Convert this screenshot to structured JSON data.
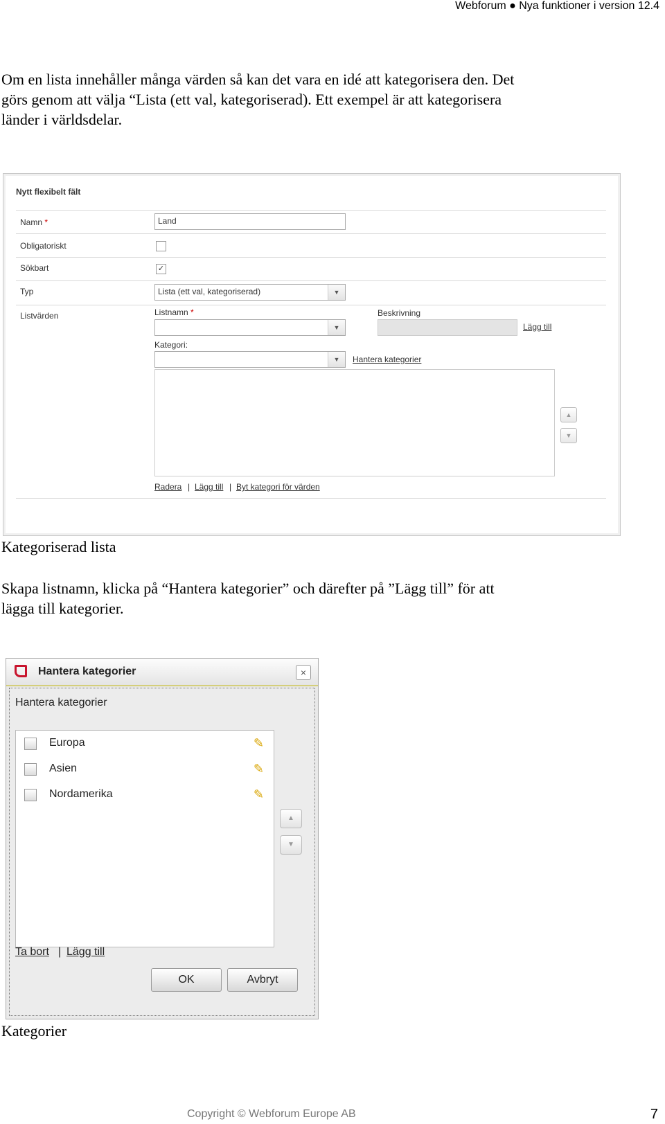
{
  "header": {
    "text": "Webforum ● Nya funktioner i version 12.4"
  },
  "intro": {
    "line1": "Om en lista innehåller många värden så kan det vara en idé att kategorisera den. Det",
    "line2": "görs genom att välja “Lista (ett val, kategoriserad). Ett exempel är att kategorisera",
    "line3": "länder i världsdelar."
  },
  "form": {
    "title": "Nytt flexibelt fält",
    "name_label": "Namn",
    "required_mark": "*",
    "name_value": "Land",
    "mandatory_label": "Obligatoriskt",
    "mandatory_checked": false,
    "searchable_label": "Sökbart",
    "searchable_checked": true,
    "check_glyph": "✓",
    "type_label": "Typ",
    "type_value": "Lista (ett val, kategoriserad)",
    "listvalues_label": "Listvärden",
    "listname_label": "Listnamn",
    "description_label": "Beskrivning",
    "add_label": "Lägg till",
    "category_label": "Kategori:",
    "manage_categories_label": "Hantera kategorier",
    "delete_label": "Radera",
    "add2_label": "Lägg till",
    "change_category_label": "Byt kategori för värden",
    "separator": "|",
    "up_icon": "▲",
    "down_icon": "▼"
  },
  "caption1": "Kategoriserad lista",
  "para2": {
    "line1": "Skapa listnamn, klicka på “Hantera kategorier” och därefter på ”Lägg till” för att",
    "line2": "lägga till kategorier."
  },
  "dialog": {
    "title": "Hantera kategorier",
    "close_icon": "×",
    "subtitle": "Hantera kategorier",
    "categories": [
      "Europa",
      "Asien",
      "Nordamerika"
    ],
    "edit_icon": "✎",
    "remove_label": "Ta bort",
    "add_label": "Lägg till",
    "separator": "|",
    "ok_label": "OK",
    "cancel_label": "Avbryt",
    "up_icon": "▲",
    "down_icon": "▼"
  },
  "caption2": "Kategorier",
  "footer": {
    "copyright": "Copyright © Webforum Europe AB",
    "page": "7"
  }
}
